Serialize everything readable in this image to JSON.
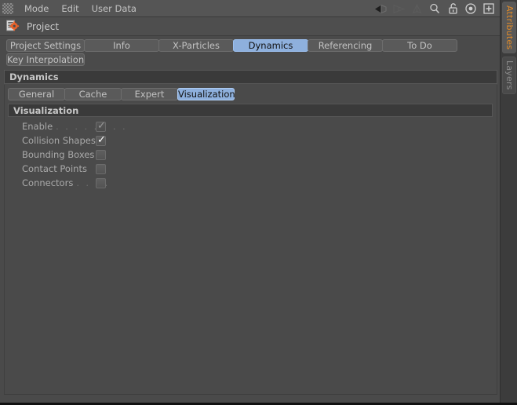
{
  "window": {
    "title": "Attributes"
  },
  "menubar": {
    "grip_icon": "grip-handle-icon",
    "items": [
      {
        "label": "Mode"
      },
      {
        "label": "Edit"
      },
      {
        "label": "User Data"
      }
    ],
    "toolbar_icons": [
      {
        "name": "back-arrow-icon",
        "glyph": "◀"
      },
      {
        "name": "forward-arrow-icon",
        "glyph": "▷"
      },
      {
        "name": "up-arrow-icon",
        "glyph": "△"
      },
      {
        "name": "search-icon",
        "glyph": "⌕"
      },
      {
        "name": "unlock-icon",
        "glyph": "🔓"
      },
      {
        "name": "target-icon",
        "glyph": "◎"
      },
      {
        "name": "add-box-icon",
        "glyph": "⊞"
      }
    ]
  },
  "object_row": {
    "icon": "project-settings-icon",
    "label": "Project"
  },
  "tabs": {
    "row1": [
      {
        "label": "Project Settings",
        "active": false,
        "class": "t-projset"
      },
      {
        "label": "Info",
        "active": false,
        "class": "t-info"
      },
      {
        "label": "X-Particles",
        "active": false,
        "class": "t-xpart"
      },
      {
        "label": "Dynamics",
        "active": true,
        "class": "t-dyn"
      },
      {
        "label": "Referencing",
        "active": false,
        "class": "t-ref"
      },
      {
        "label": "To Do",
        "active": false,
        "class": "t-todo"
      }
    ],
    "row2": [
      {
        "label": "Key Interpolation",
        "active": false,
        "class": "t-keyint"
      }
    ]
  },
  "dynamics": {
    "header": "Dynamics",
    "subtabs": [
      {
        "label": "General",
        "active": false,
        "class": "s-gen"
      },
      {
        "label": "Cache",
        "active": false,
        "class": "s-cac"
      },
      {
        "label": "Expert",
        "active": false,
        "class": "s-exp"
      },
      {
        "label": "Visualization",
        "active": true,
        "class": "s-vis"
      }
    ]
  },
  "visualization": {
    "header": "Visualization",
    "properties": [
      {
        "label": "Enable",
        "leader": ". . . . . . . .",
        "checked": true,
        "dim": true,
        "name": "enable"
      },
      {
        "label": "Collision Shapes",
        "leader": "",
        "checked": true,
        "dim": false,
        "name": "collision-shapes"
      },
      {
        "label": "Bounding Boxes",
        "leader": "",
        "checked": false,
        "dim": false,
        "name": "bounding-boxes"
      },
      {
        "label": "Contact Points",
        "leader": "",
        "checked": false,
        "dim": false,
        "name": "contact-points"
      },
      {
        "label": "Connectors",
        "leader": ". . . .",
        "checked": false,
        "dim": false,
        "name": "connectors"
      }
    ]
  },
  "vertical_tabs": [
    {
      "label": "Attributes",
      "active": true,
      "id": "vtab-attributes"
    },
    {
      "label": "Layers",
      "active": false,
      "id": "vtab-layers"
    }
  ],
  "colors": {
    "accent_active_tab": "#8eb0dd",
    "accent_orange": "#e08a28",
    "panel_bg": "#4a4a4a",
    "header_bg": "#3a3a3a",
    "menubar_bg": "#555555"
  }
}
